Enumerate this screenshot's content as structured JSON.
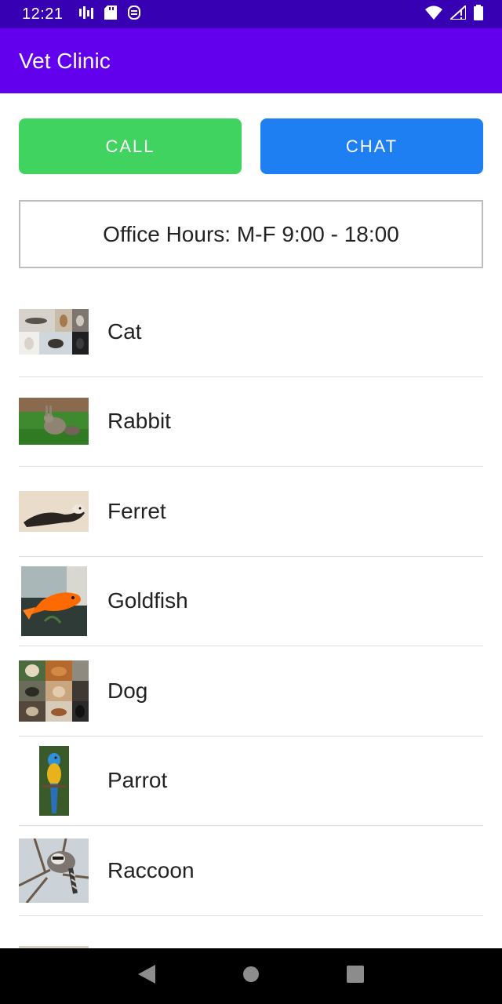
{
  "status_bar": {
    "time": "12:21",
    "icons_left": [
      "signal-bars-icon",
      "sd-card-icon",
      "sync-icon"
    ],
    "icons_right": [
      "wifi-icon",
      "cellular-icon",
      "battery-icon"
    ]
  },
  "app_bar": {
    "title": "Vet Clinic"
  },
  "actions": {
    "call_label": "CALL",
    "chat_label": "CHAT"
  },
  "colors": {
    "call": "#41d35f",
    "chat": "#1e7ff2",
    "app_bar": "#6200ee",
    "status_bar": "#3700b3"
  },
  "office_hours": "Office Hours: M-F 9:00 - 18:00",
  "animals": [
    {
      "name": "Cat",
      "image": "cats-collage-image"
    },
    {
      "name": "Rabbit",
      "image": "rabbit-photo"
    },
    {
      "name": "Ferret",
      "image": "ferret-photo"
    },
    {
      "name": "Goldfish",
      "image": "goldfish-photo"
    },
    {
      "name": "Dog",
      "image": "dogs-collage-image"
    },
    {
      "name": "Parrot",
      "image": "parrot-photo"
    },
    {
      "name": "Raccoon",
      "image": "raccoon-photo"
    }
  ],
  "nav": [
    "back-icon",
    "home-icon",
    "recents-icon"
  ]
}
